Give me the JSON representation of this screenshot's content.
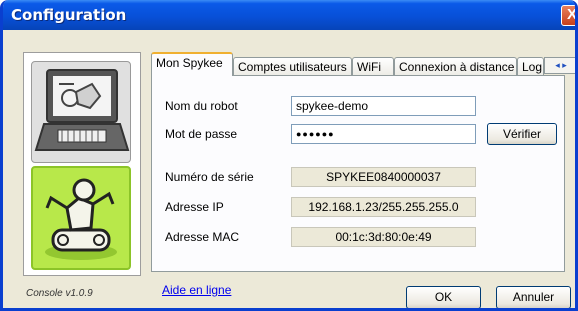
{
  "window": {
    "title": "Configuration",
    "close_symbol": "X"
  },
  "sidebar": {
    "items": [
      {
        "name": "console-nav",
        "icon": "laptop-robot-icon"
      },
      {
        "name": "spykee-nav",
        "icon": "spykee-robot-icon",
        "selected": true
      }
    ],
    "version": "Console v1.0.9"
  },
  "tabs": {
    "items": [
      "Mon Spykee",
      "Comptes utilisateurs",
      "WiFi",
      "Connexion à distance",
      "Log"
    ],
    "active": "Mon Spykee",
    "scroll_left": "◂",
    "scroll_right": "▸"
  },
  "form": {
    "robot_name_label": "Nom du robot",
    "robot_name_value": "spykee-demo",
    "password_label": "Mot de passe",
    "password_value": "●●●●●●",
    "verify_button": "Vérifier",
    "serial_label": "Numéro de série",
    "serial_value": "SPYKEE0840000037",
    "ip_label": "Adresse IP",
    "ip_value": "192.168.1.23/255.255.255.0",
    "mac_label": "Adresse MAC",
    "mac_value": "00:1c:3d:80:0e:49"
  },
  "footer": {
    "help_link": "Aide en ligne",
    "ok_button": "OK",
    "cancel_button": "Annuler"
  },
  "colors": {
    "titlebar": "#0850d8",
    "selected_nav": "#b8e84a",
    "window_bg": "#ece9d8",
    "link": "#0000ee"
  }
}
